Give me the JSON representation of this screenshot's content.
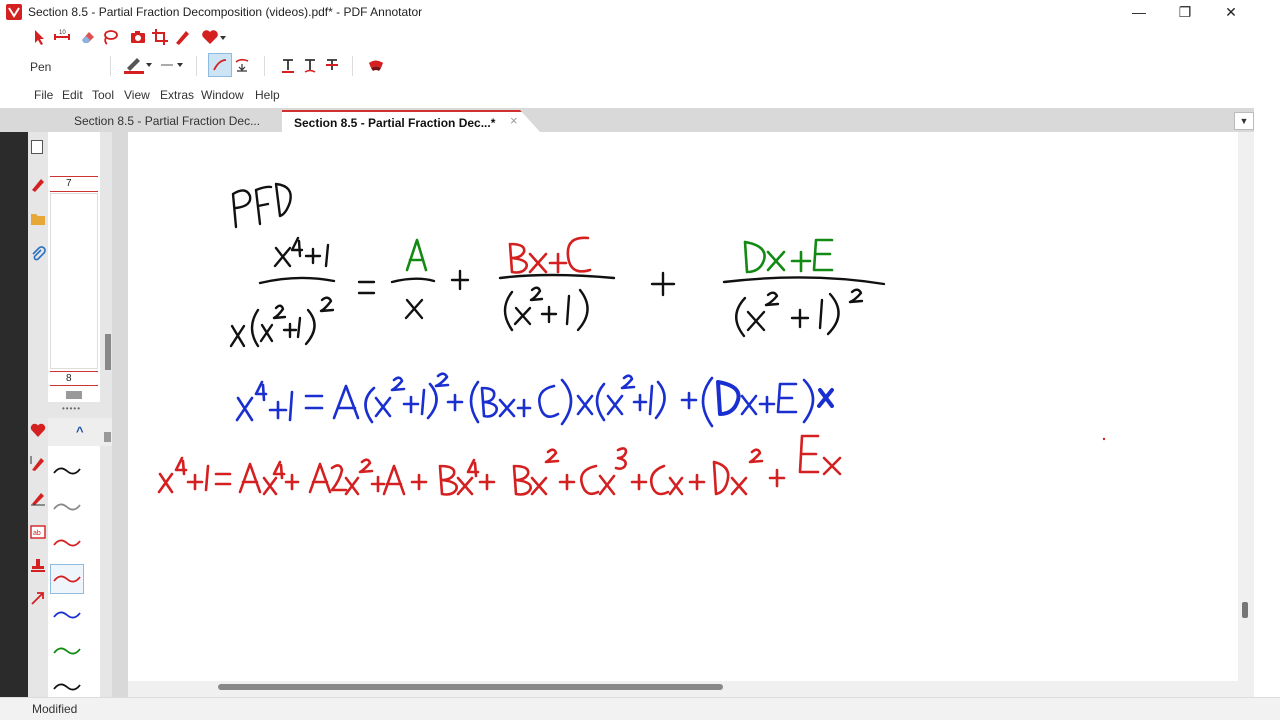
{
  "window": {
    "title": "Section 8.5 - Partial Fraction Decomposition (videos).pdf* - PDF Annotator",
    "controls": {
      "minimize": "—",
      "maximize": "❐",
      "close": "✕"
    }
  },
  "toolbar": {
    "current_tool": "Pen",
    "pen_color": "#d42020",
    "icons_row1": [
      "select-icon",
      "pan-icon",
      "eraser-icon",
      "lasso-icon",
      "camera-icon",
      "crop-icon",
      "pen-tool-icon",
      "favorites-icon"
    ],
    "icons_row2": [
      "pen-color-icon",
      "line-style-icon",
      "smooth-pen-icon",
      "snap-pen-icon",
      "text-icon",
      "text-underline-icon",
      "strikeout-icon",
      "highlighter-icon"
    ]
  },
  "menu": {
    "items": [
      "File",
      "Edit",
      "Tool",
      "View",
      "Extras",
      "Window",
      "Help"
    ]
  },
  "tabs": [
    {
      "label": "Section 8.5 - Partial Fraction Dec...",
      "active": false
    },
    {
      "label": "Section 8.5 - Partial Fraction Dec...*",
      "active": true
    }
  ],
  "tab_close": "×",
  "tab_dropdown": "▼",
  "sidebar": {
    "page_numbers": [
      "7",
      "8"
    ],
    "splitter": "•••••",
    "favorites_collapse": "^"
  },
  "favorites_pens": [
    {
      "color": "#111111"
    },
    {
      "color": "#888888"
    },
    {
      "color": "#d42020"
    },
    {
      "color": "#d42020",
      "selected": true
    },
    {
      "color": "#1a2fd0"
    },
    {
      "color": "#138a13"
    },
    {
      "color": "#111111"
    }
  ],
  "handwriting": {
    "line0": "PFD",
    "line1_lhs_num": "x⁴+1",
    "line1_lhs_den": "x(x²+1)²",
    "line1_eq": "=",
    "line1_t1_num": "A",
    "line1_t1_den": "x",
    "line1_plus": "+",
    "line1_t2_num": "Bx+C",
    "line1_t2_den": "(x²+1)",
    "line1_t3_num": "Dx+E",
    "line1_t3_den": "(x²+1)²",
    "line2": "x⁴+1 = A(x²+1)²+(Bx+C)x(x²+1)+(Dx+E)x",
    "line3": "x⁴+1 = Ax⁴+A2x²+A + Bx⁴+Bx²+Cx³+Cx + Dx² + Ex",
    "colors": {
      "black": "#111111",
      "green": "#138a13",
      "red": "#d42020",
      "blue": "#1a2fd0"
    }
  },
  "status": "Modified"
}
